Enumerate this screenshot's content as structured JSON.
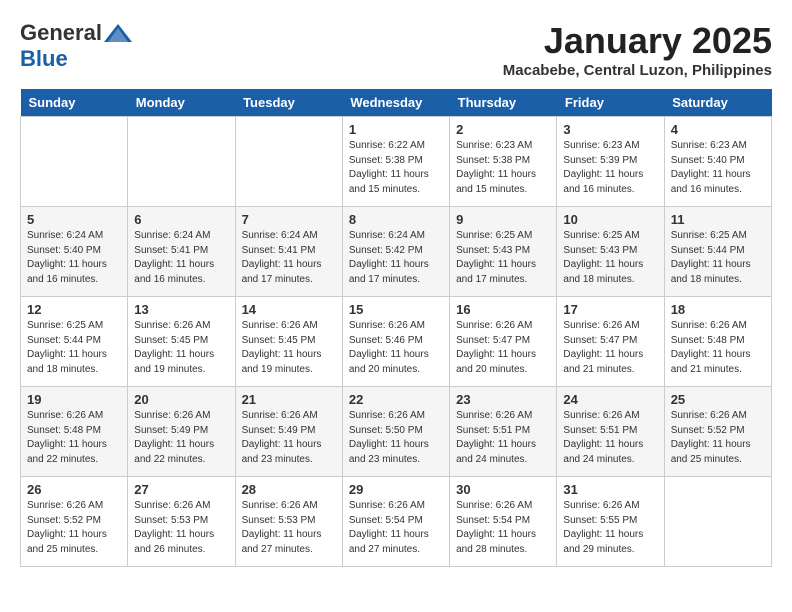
{
  "logo": {
    "general": "General",
    "blue": "Blue"
  },
  "title": "January 2025",
  "subtitle": "Macabebe, Central Luzon, Philippines",
  "headers": [
    "Sunday",
    "Monday",
    "Tuesday",
    "Wednesday",
    "Thursday",
    "Friday",
    "Saturday"
  ],
  "weeks": [
    [
      {
        "day": "",
        "info": ""
      },
      {
        "day": "",
        "info": ""
      },
      {
        "day": "",
        "info": ""
      },
      {
        "day": "1",
        "info": "Sunrise: 6:22 AM\nSunset: 5:38 PM\nDaylight: 11 hours\nand 15 minutes."
      },
      {
        "day": "2",
        "info": "Sunrise: 6:23 AM\nSunset: 5:38 PM\nDaylight: 11 hours\nand 15 minutes."
      },
      {
        "day": "3",
        "info": "Sunrise: 6:23 AM\nSunset: 5:39 PM\nDaylight: 11 hours\nand 16 minutes."
      },
      {
        "day": "4",
        "info": "Sunrise: 6:23 AM\nSunset: 5:40 PM\nDaylight: 11 hours\nand 16 minutes."
      }
    ],
    [
      {
        "day": "5",
        "info": "Sunrise: 6:24 AM\nSunset: 5:40 PM\nDaylight: 11 hours\nand 16 minutes."
      },
      {
        "day": "6",
        "info": "Sunrise: 6:24 AM\nSunset: 5:41 PM\nDaylight: 11 hours\nand 16 minutes."
      },
      {
        "day": "7",
        "info": "Sunrise: 6:24 AM\nSunset: 5:41 PM\nDaylight: 11 hours\nand 17 minutes."
      },
      {
        "day": "8",
        "info": "Sunrise: 6:24 AM\nSunset: 5:42 PM\nDaylight: 11 hours\nand 17 minutes."
      },
      {
        "day": "9",
        "info": "Sunrise: 6:25 AM\nSunset: 5:43 PM\nDaylight: 11 hours\nand 17 minutes."
      },
      {
        "day": "10",
        "info": "Sunrise: 6:25 AM\nSunset: 5:43 PM\nDaylight: 11 hours\nand 18 minutes."
      },
      {
        "day": "11",
        "info": "Sunrise: 6:25 AM\nSunset: 5:44 PM\nDaylight: 11 hours\nand 18 minutes."
      }
    ],
    [
      {
        "day": "12",
        "info": "Sunrise: 6:25 AM\nSunset: 5:44 PM\nDaylight: 11 hours\nand 18 minutes."
      },
      {
        "day": "13",
        "info": "Sunrise: 6:26 AM\nSunset: 5:45 PM\nDaylight: 11 hours\nand 19 minutes."
      },
      {
        "day": "14",
        "info": "Sunrise: 6:26 AM\nSunset: 5:45 PM\nDaylight: 11 hours\nand 19 minutes."
      },
      {
        "day": "15",
        "info": "Sunrise: 6:26 AM\nSunset: 5:46 PM\nDaylight: 11 hours\nand 20 minutes."
      },
      {
        "day": "16",
        "info": "Sunrise: 6:26 AM\nSunset: 5:47 PM\nDaylight: 11 hours\nand 20 minutes."
      },
      {
        "day": "17",
        "info": "Sunrise: 6:26 AM\nSunset: 5:47 PM\nDaylight: 11 hours\nand 21 minutes."
      },
      {
        "day": "18",
        "info": "Sunrise: 6:26 AM\nSunset: 5:48 PM\nDaylight: 11 hours\nand 21 minutes."
      }
    ],
    [
      {
        "day": "19",
        "info": "Sunrise: 6:26 AM\nSunset: 5:48 PM\nDaylight: 11 hours\nand 22 minutes."
      },
      {
        "day": "20",
        "info": "Sunrise: 6:26 AM\nSunset: 5:49 PM\nDaylight: 11 hours\nand 22 minutes."
      },
      {
        "day": "21",
        "info": "Sunrise: 6:26 AM\nSunset: 5:49 PM\nDaylight: 11 hours\nand 23 minutes."
      },
      {
        "day": "22",
        "info": "Sunrise: 6:26 AM\nSunset: 5:50 PM\nDaylight: 11 hours\nand 23 minutes."
      },
      {
        "day": "23",
        "info": "Sunrise: 6:26 AM\nSunset: 5:51 PM\nDaylight: 11 hours\nand 24 minutes."
      },
      {
        "day": "24",
        "info": "Sunrise: 6:26 AM\nSunset: 5:51 PM\nDaylight: 11 hours\nand 24 minutes."
      },
      {
        "day": "25",
        "info": "Sunrise: 6:26 AM\nSunset: 5:52 PM\nDaylight: 11 hours\nand 25 minutes."
      }
    ],
    [
      {
        "day": "26",
        "info": "Sunrise: 6:26 AM\nSunset: 5:52 PM\nDaylight: 11 hours\nand 25 minutes."
      },
      {
        "day": "27",
        "info": "Sunrise: 6:26 AM\nSunset: 5:53 PM\nDaylight: 11 hours\nand 26 minutes."
      },
      {
        "day": "28",
        "info": "Sunrise: 6:26 AM\nSunset: 5:53 PM\nDaylight: 11 hours\nand 27 minutes."
      },
      {
        "day": "29",
        "info": "Sunrise: 6:26 AM\nSunset: 5:54 PM\nDaylight: 11 hours\nand 27 minutes."
      },
      {
        "day": "30",
        "info": "Sunrise: 6:26 AM\nSunset: 5:54 PM\nDaylight: 11 hours\nand 28 minutes."
      },
      {
        "day": "31",
        "info": "Sunrise: 6:26 AM\nSunset: 5:55 PM\nDaylight: 11 hours\nand 29 minutes."
      },
      {
        "day": "",
        "info": ""
      }
    ]
  ]
}
